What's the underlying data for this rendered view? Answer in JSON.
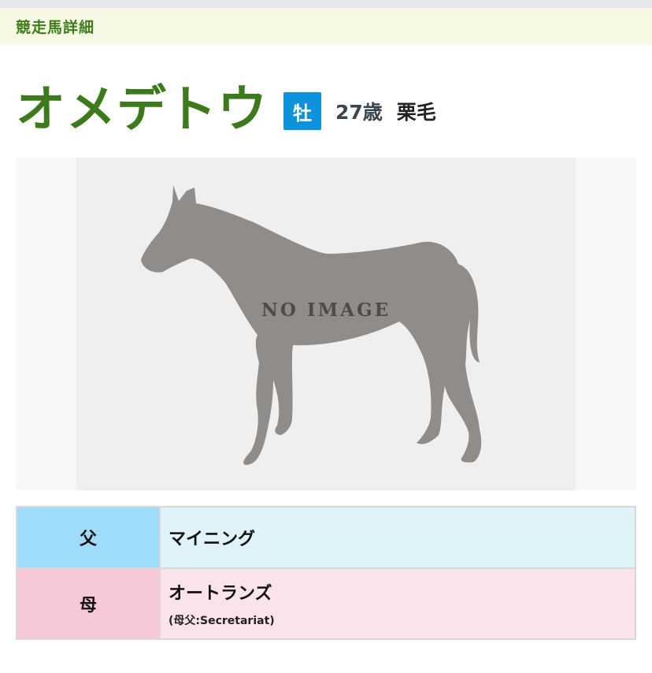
{
  "section": {
    "title": "競走馬詳細"
  },
  "horse": {
    "name": "オメデトウ",
    "sex": "牡",
    "age": "27歳",
    "coat": "栗毛"
  },
  "image": {
    "placeholder_text": "NO IMAGE",
    "silhouette_icon": "horse-silhouette"
  },
  "pedigree": {
    "sire": {
      "label": "父",
      "name": "マイニング"
    },
    "dam": {
      "label": "母",
      "name": "オートランズ",
      "note": "(母父:Secretariat)"
    }
  },
  "colors": {
    "accent_green": "#3d7a1c",
    "sex_badge": "#0e92dc",
    "sire_label_bg": "#9fdcfb",
    "sire_value_bg": "#e0f3fb",
    "dam_label_bg": "#f7c9d6",
    "dam_value_bg": "#fbe3ea"
  }
}
